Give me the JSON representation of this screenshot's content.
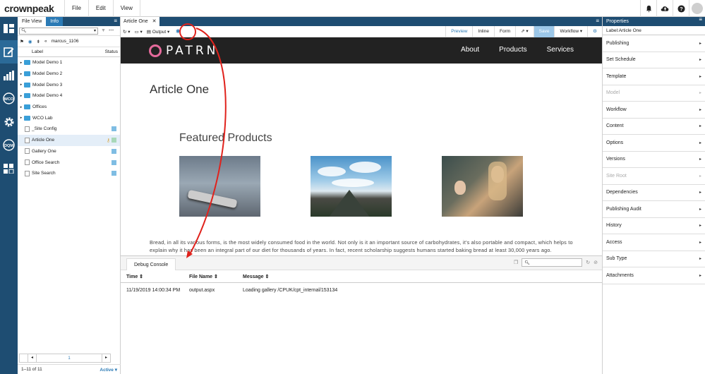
{
  "app": {
    "logo_text": "crownpeak",
    "menu": [
      "File",
      "Edit",
      "View"
    ]
  },
  "rail": {
    "items": [
      "dashboard-icon",
      "edit-icon",
      "reports-icon",
      "WCO",
      "settings-icon",
      "DQM",
      "blocks-icon"
    ]
  },
  "files": {
    "tab_file_view": "File View",
    "tab_info": "Info",
    "path_user": "marcus_1106",
    "col_label": "Label",
    "col_status": "Status",
    "rows": [
      {
        "label": "Model Demo 1",
        "kind": "folder",
        "status": ""
      },
      {
        "label": "Model Demo 2",
        "kind": "folder",
        "status": ""
      },
      {
        "label": "Model Demo 3",
        "kind": "folder",
        "status": ""
      },
      {
        "label": "Model Demo 4",
        "kind": "folder",
        "status": ""
      },
      {
        "label": "Offices",
        "kind": "folder",
        "status": ""
      },
      {
        "label": "WCO Lab",
        "kind": "folder",
        "status": ""
      },
      {
        "label": "_Site Config",
        "kind": "page",
        "status": "#7fbde3"
      },
      {
        "label": "Article One",
        "kind": "page",
        "status": "#a8d8b9",
        "selected": true
      },
      {
        "label": "Gallery One",
        "kind": "page",
        "status": "#7fbde3"
      },
      {
        "label": "Office Search",
        "kind": "page",
        "status": "#7fbde3"
      },
      {
        "label": "Site Search",
        "kind": "page",
        "status": "#7fbde3"
      }
    ],
    "pager_page": "1",
    "count": "1–11 of 11",
    "filter": "Active"
  },
  "doc": {
    "tab_title": "Article One",
    "output_label": "Output",
    "right_tools": [
      "Preview",
      "Inline",
      "Form",
      "Save",
      "Workflow"
    ]
  },
  "site": {
    "brand": "PATRN",
    "nav": [
      "About",
      "Products",
      "Services"
    ],
    "article_title": "Article One",
    "featured_title": "Featured Products",
    "body": "Bread, in all its various forms, is the most widely consumed food in the world. Not only is it an important source of carbohydrates, it's also portable and compact, which helps to explain why it has been an integral part of our diet for thousands of years. In fact, recent scholarship suggests humans started baking bread at least 30,000 years ago."
  },
  "console": {
    "tab": "Debug Console",
    "headers": {
      "time": "Time",
      "file": "File Name",
      "message": "Message"
    },
    "rows": [
      {
        "time": "11/19/2019 14:00:34 PM",
        "file": "output.aspx",
        "message": "Loading gallery /CPUK/cpt_internal/153134"
      }
    ]
  },
  "properties": {
    "title": "Properties",
    "label_line": "Label:Article One",
    "items": [
      {
        "label": "Publishing",
        "disabled": false
      },
      {
        "label": "Set Schedule",
        "disabled": false
      },
      {
        "label": "Template",
        "disabled": false
      },
      {
        "label": "Model",
        "disabled": true
      },
      {
        "label": "Workflow",
        "disabled": false
      },
      {
        "label": "Content",
        "disabled": false
      },
      {
        "label": "Options",
        "disabled": false
      },
      {
        "label": "Versions",
        "disabled": false
      },
      {
        "label": "Site Root",
        "disabled": true
      },
      {
        "label": "Dependencies",
        "disabled": false
      },
      {
        "label": "Publishing Audit",
        "disabled": false
      },
      {
        "label": "History",
        "disabled": false
      },
      {
        "label": "Access",
        "disabled": false
      },
      {
        "label": "Sub Type",
        "disabled": false
      },
      {
        "label": "Attachments",
        "disabled": false
      }
    ]
  },
  "colors": {
    "nav_blue": "#1e4d72",
    "accent": "#2b7ab5",
    "annotation_red": "#e0221c"
  }
}
